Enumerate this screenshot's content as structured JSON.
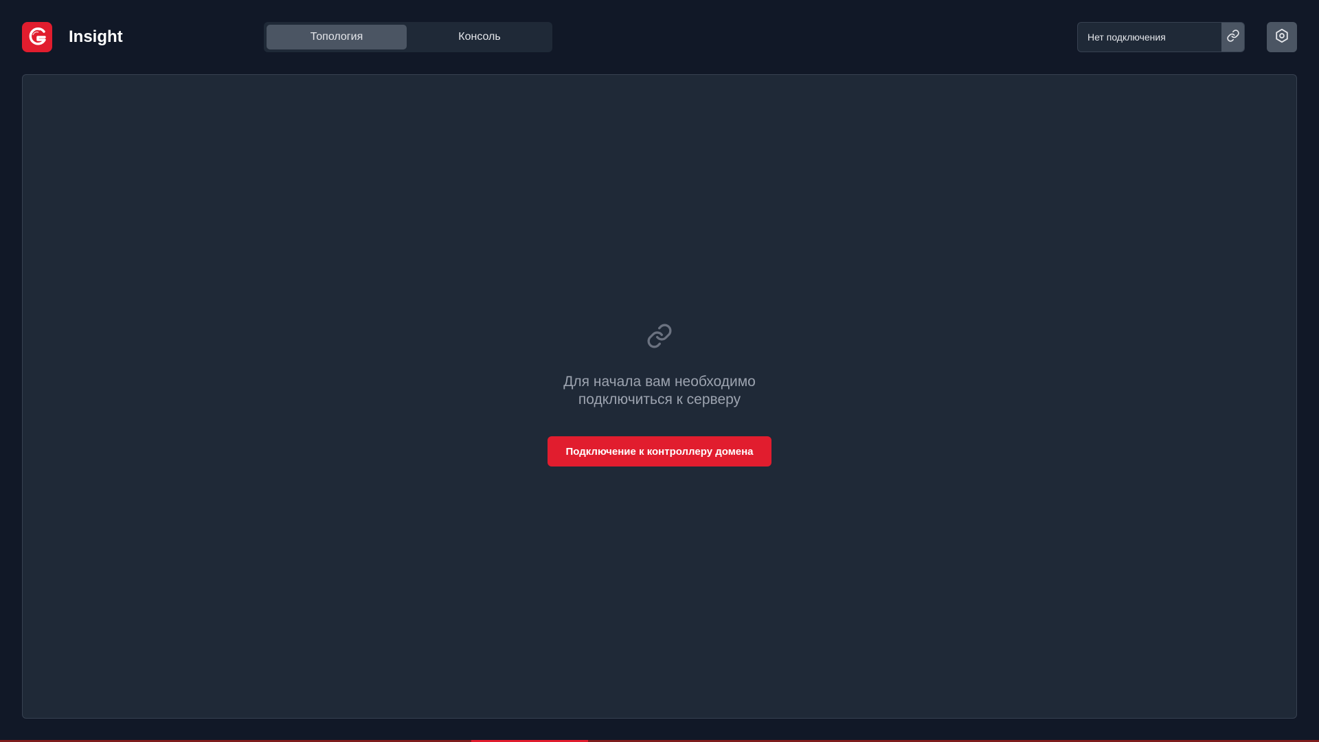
{
  "app": {
    "title": "Insight"
  },
  "tabs": [
    {
      "label": "Топология",
      "active": true
    },
    {
      "label": "Консоль",
      "active": false
    }
  ],
  "connection": {
    "status_placeholder": "Нет подключения",
    "button_icon": "link-icon"
  },
  "settings": {
    "icon": "gear-icon"
  },
  "empty_state": {
    "icon": "link-icon",
    "line1": "Для начала вам необходимо",
    "line2": "подключиться к серверу",
    "button_label": "Подключение к контроллеру домена"
  },
  "colors": {
    "background": "#111827",
    "panel": "#1f2937",
    "accent": "#e11d2e",
    "muted_text": "#9ca3af"
  }
}
